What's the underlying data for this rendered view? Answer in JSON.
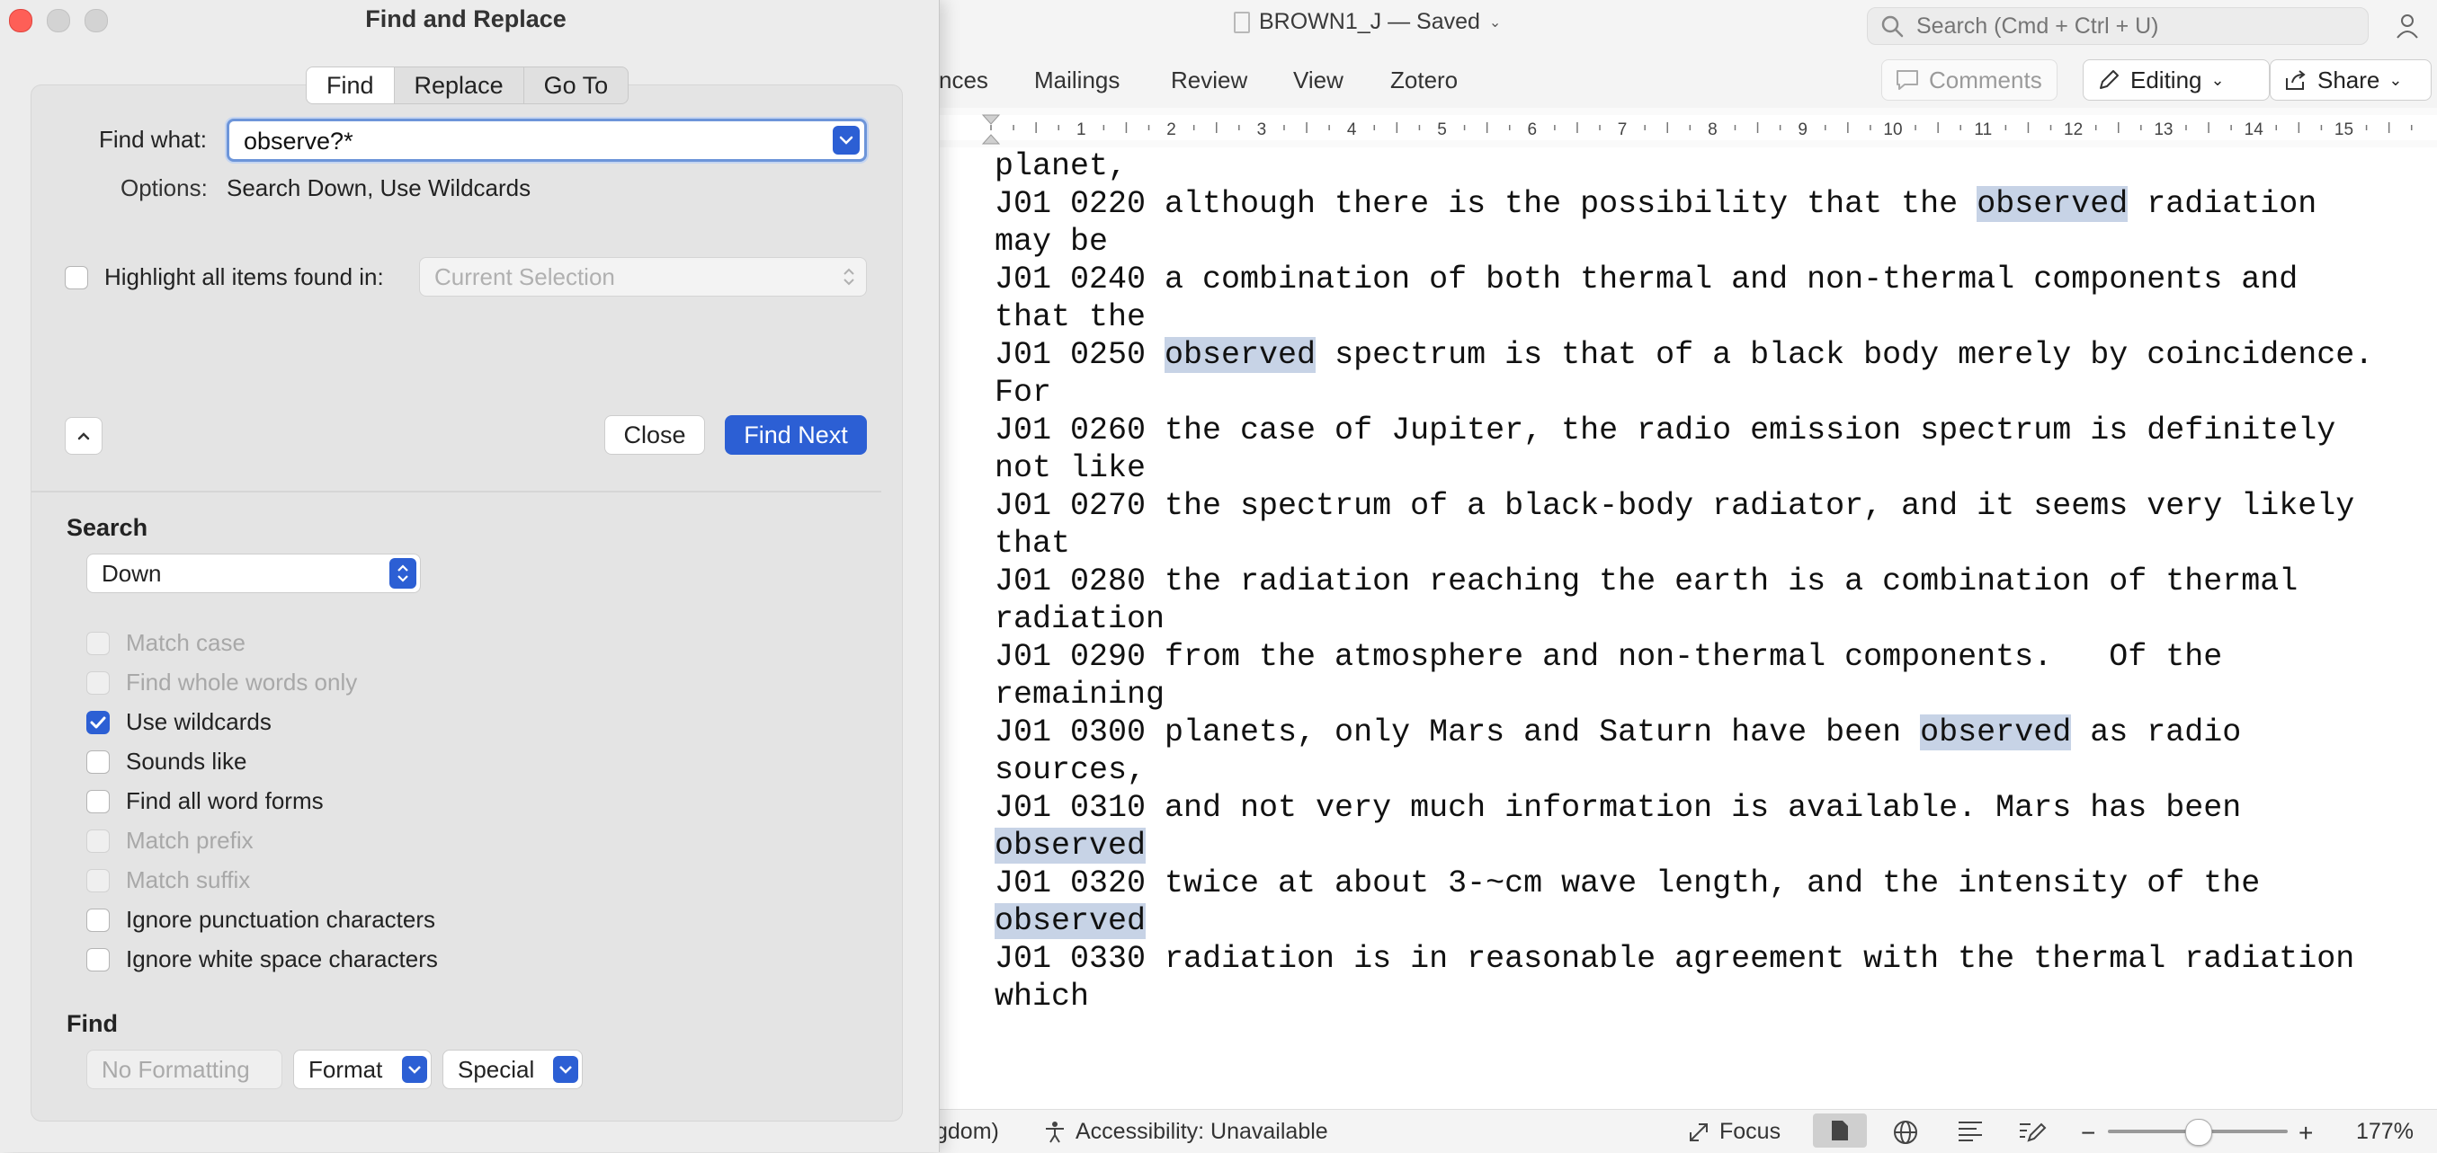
{
  "word": {
    "doc_title": "BROWN1_J — Saved",
    "search_placeholder": "Search (Cmd + Ctrl + U)",
    "ribbon_tabs": [
      "nces",
      "Mailings",
      "Review",
      "View",
      "Zotero"
    ],
    "comments_label": "Comments",
    "editing_label": "Editing",
    "share_label": "Share",
    "ruler_numbers": [
      "1",
      "2",
      "3",
      "4",
      "5",
      "6",
      "7",
      "8",
      "9",
      "10",
      "11",
      "12",
      "13",
      "14",
      "15"
    ],
    "document_lines": [
      "planet,",
      "J01 0220 although there is the possibility that the observed radiation",
      "may be",
      "J01 0240 a combination of both thermal and non-thermal components and",
      "that the",
      "J01 0250 observed spectrum is that of a black body merely by coincidence.",
      "For",
      "J01 0260 the case of Jupiter, the radio emission spectrum is definitely",
      "not like",
      "J01 0270 the spectrum of a black-body radiator, and it seems very likely",
      "that",
      "J01 0280 the radiation reaching the earth is a combination of thermal",
      "radiation",
      "J01 0290 from the atmosphere and non-thermal components.   Of the",
      "remaining",
      "J01 0300 planets, only Mars and Saturn have been observed as radio",
      "sources,",
      "J01 0310 and not very much information is available. Mars has been",
      "observed",
      "J01 0320 twice at about 3-~cm wave length, and the intensity of the",
      "observed",
      "J01 0330 radiation is in reasonable agreement with the thermal radiation",
      "which"
    ],
    "highlight_word": "observed",
    "status": {
      "language": "gdom)",
      "accessibility": "Accessibility: Unavailable",
      "focus": "Focus",
      "zoom_minus": "−",
      "zoom_plus": "+",
      "zoom": "177%"
    },
    "zoom_level_fraction": 0.5
  },
  "dialog": {
    "title": "Find and Replace",
    "tabs": [
      "Find",
      "Replace",
      "Go To"
    ],
    "active_tab": "Find",
    "find_label": "Find what:",
    "find_value": "observe?*",
    "options_label": "Options:",
    "options_value": "Search Down, Use Wildcards",
    "highlight_label": "Highlight all items found in:",
    "highlight_select": "Current Selection",
    "close_label": "Close",
    "find_next_label": "Find Next",
    "search_heading": "Search",
    "direction": "Down",
    "options": [
      {
        "label": "Match case",
        "checked": false,
        "disabled": true
      },
      {
        "label": "Find whole words only",
        "checked": false,
        "disabled": true
      },
      {
        "label": "Use wildcards",
        "checked": true,
        "disabled": false
      },
      {
        "label": "Sounds like",
        "checked": false,
        "disabled": false
      },
      {
        "label": "Find all word forms",
        "checked": false,
        "disabled": false
      },
      {
        "label": "Match prefix",
        "checked": false,
        "disabled": true
      },
      {
        "label": "Match suffix",
        "checked": false,
        "disabled": true
      },
      {
        "label": "Ignore punctuation characters",
        "checked": false,
        "disabled": false
      },
      {
        "label": "Ignore white space characters",
        "checked": false,
        "disabled": false
      }
    ],
    "find_heading": "Find",
    "no_formatting_label": "No Formatting",
    "format_label": "Format",
    "special_label": "Special"
  },
  "colors": {
    "accent": "#2c5fd4",
    "highlight": "#c7d3e6",
    "close_light": "#fe5f57"
  }
}
